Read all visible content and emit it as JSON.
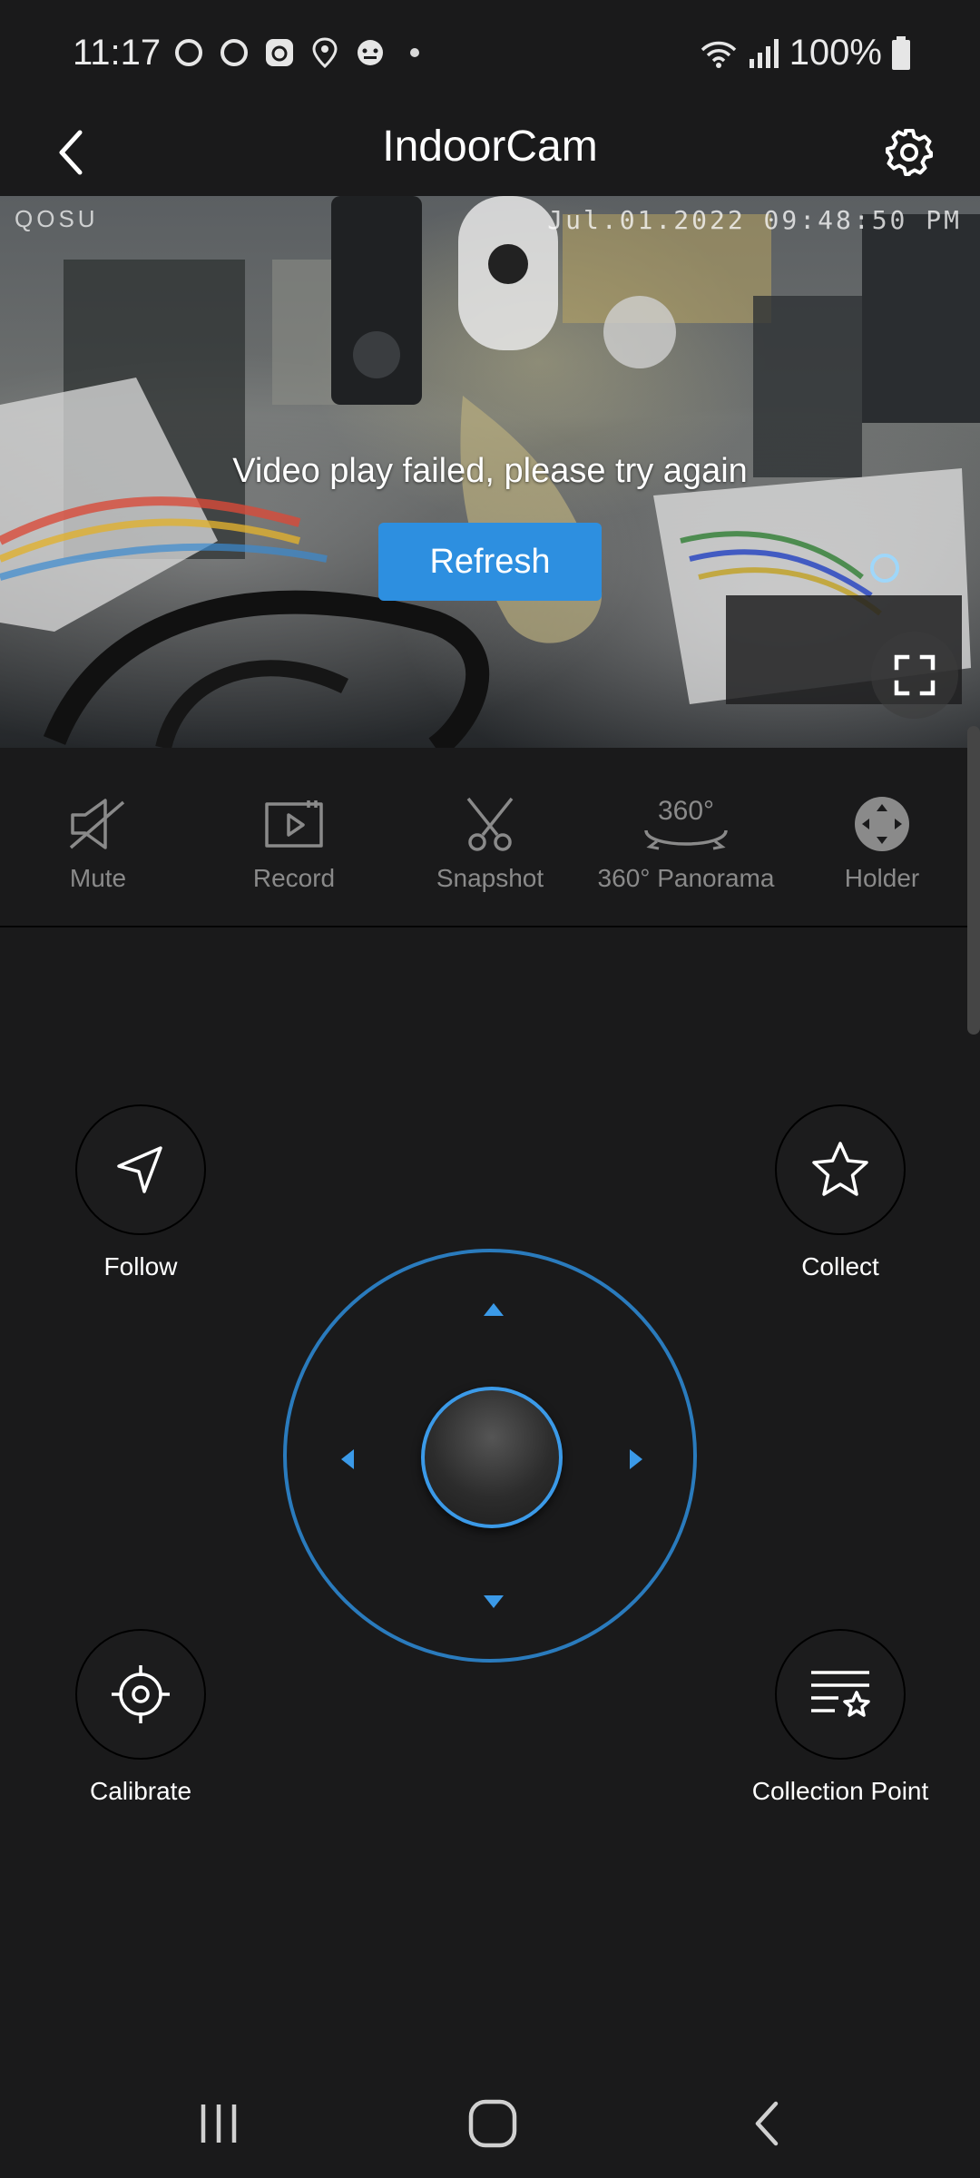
{
  "status_bar": {
    "time": "11:17",
    "battery": "100%",
    "left_icons": [
      "threads-icon",
      "threads-icon",
      "app-a-icon",
      "location-pin-icon",
      "game-icon"
    ]
  },
  "header": {
    "title": "IndoorCam",
    "back_icon": "chevron-left-icon",
    "settings_icon": "gear-icon"
  },
  "video": {
    "brand": "QOSU",
    "timestamp": "Jul.01.2022 09:48:50 PM",
    "error_message": "Video play failed, please try again",
    "refresh_label": "Refresh"
  },
  "toolbar": {
    "items": [
      {
        "label": "Mute",
        "icon": "speaker-muted-icon"
      },
      {
        "label": "Record",
        "icon": "video-record-icon"
      },
      {
        "label": "Snapshot",
        "icon": "scissors-icon"
      },
      {
        "label": "360° Panorama",
        "icon": "panorama-360-icon",
        "icon_text": "360°"
      },
      {
        "label": "Holder",
        "icon": "dpad-icon"
      }
    ]
  },
  "ptz": {
    "follow_label": "Follow",
    "collect_label": "Collect",
    "calibrate_label": "Calibrate",
    "collection_point_label": "Collection Point"
  },
  "colors": {
    "background": "#1a1a1b",
    "accent": "#2d8fe0",
    "joystick_ring": "#2a7bbd",
    "muted_text": "#8a8a8a"
  }
}
